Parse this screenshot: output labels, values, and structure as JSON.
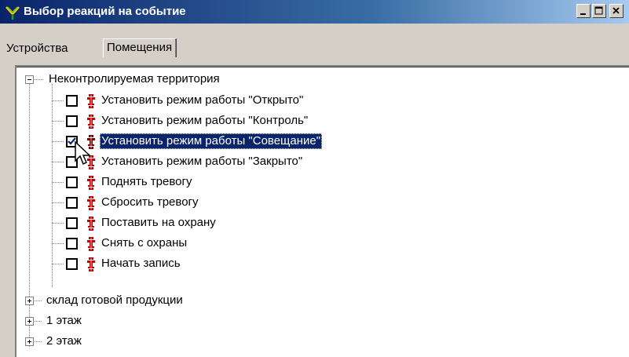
{
  "window": {
    "title": "Выбор реакций на событие",
    "icon": "reaction-app-icon",
    "controls": [
      "minimize-icon",
      "maximize-icon",
      "close-icon"
    ]
  },
  "tabs": [
    {
      "label": "Устройства",
      "active": false
    },
    {
      "label": "Помещения",
      "active": true
    }
  ],
  "tree": {
    "root": {
      "label": "Неконтролируемая территория",
      "expanded": true
    },
    "actions": [
      {
        "label": "Установить режим работы \"Открыто\"",
        "checked": false,
        "selected": false
      },
      {
        "label": "Установить режим работы \"Контроль\"",
        "checked": false,
        "selected": false
      },
      {
        "label": "Установить режим работы \"Совещание\"",
        "checked": true,
        "selected": true
      },
      {
        "label": "Установить режим работы \"Закрыто\"",
        "checked": false,
        "selected": false
      },
      {
        "label": "Поднять тревогу",
        "checked": false,
        "selected": false
      },
      {
        "label": "Сбросить тревогу",
        "checked": false,
        "selected": false
      },
      {
        "label": "Поставить на охрану",
        "checked": false,
        "selected": false
      },
      {
        "label": "Снять с охраны",
        "checked": false,
        "selected": false
      },
      {
        "label": "Начать запись",
        "checked": false,
        "selected": false
      }
    ],
    "groups": [
      {
        "label": "склад готовой продукции",
        "expanded": false
      },
      {
        "label": "1 этаж",
        "expanded": false
      },
      {
        "label": "2 этаж",
        "expanded": false
      }
    ]
  },
  "colors": {
    "titlebar": "#0a246a",
    "selection": "#0a246a",
    "reaction_icon": "#c00000",
    "window_face": "#d4d0c8"
  }
}
